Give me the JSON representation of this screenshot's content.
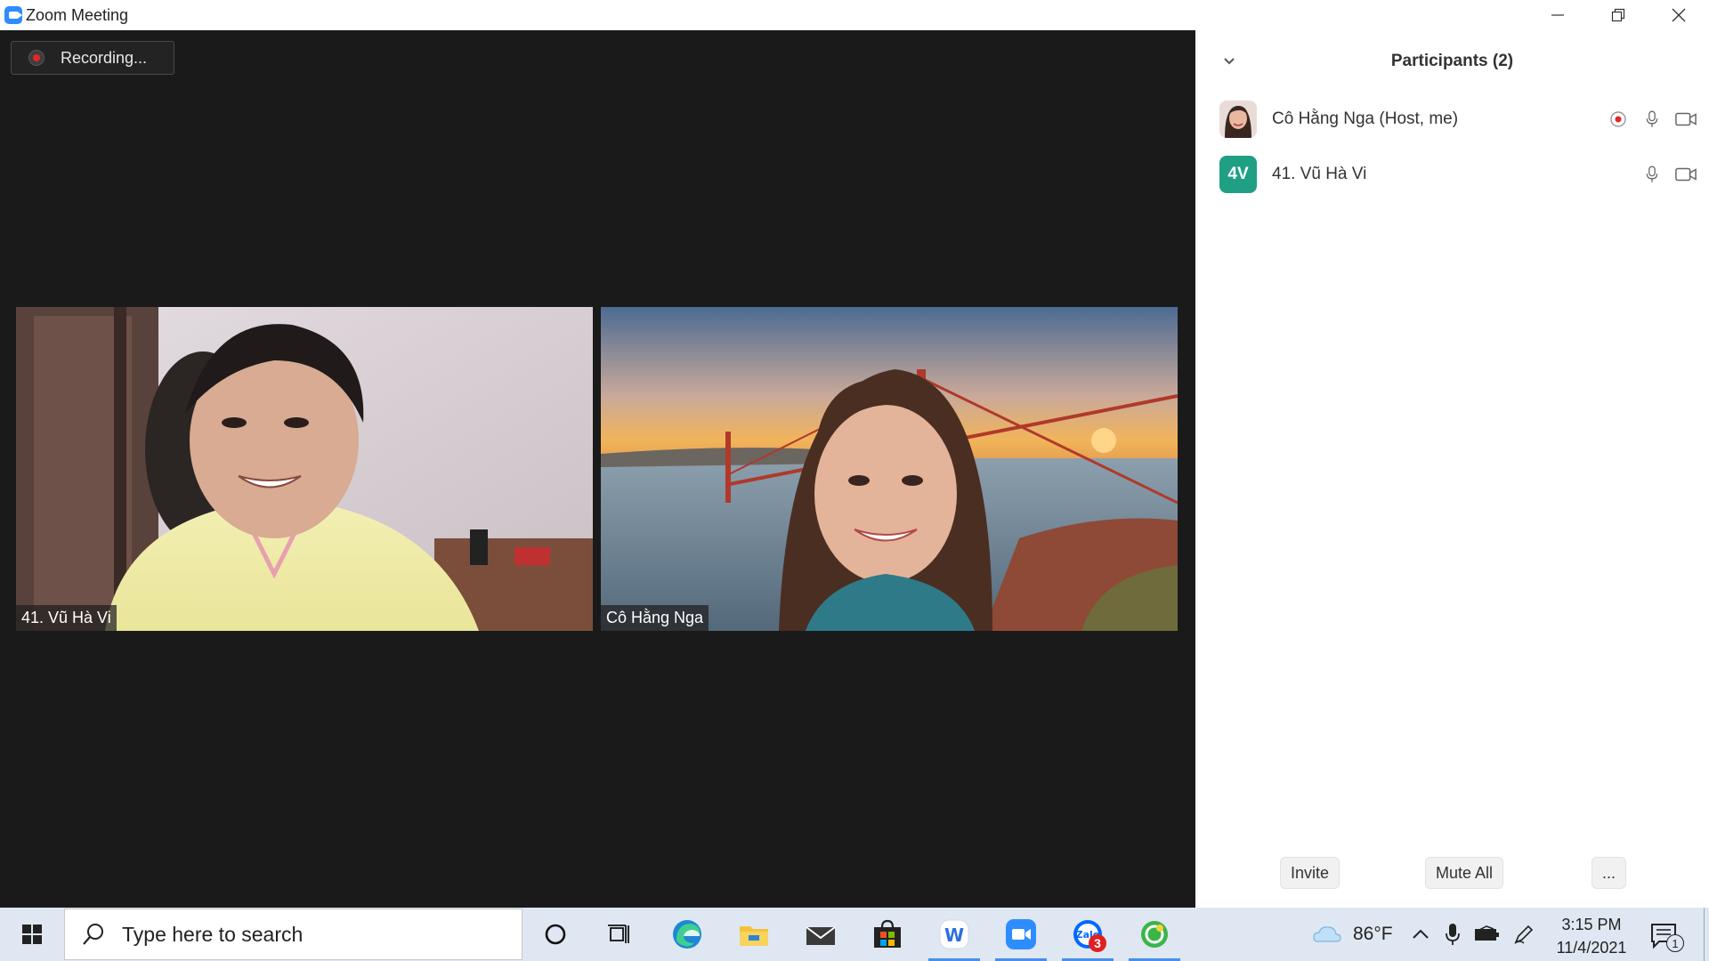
{
  "window": {
    "title": "Zoom Meeting"
  },
  "meeting": {
    "recording_label": "Recording...",
    "tiles": [
      {
        "name": "41. Vũ Hà Vi"
      },
      {
        "name": "Cô Hằng Nga"
      }
    ]
  },
  "participants_panel": {
    "title": "Participants (2)",
    "participants": [
      {
        "name": "Cô Hằng Nga (Host, me)",
        "avatar_type": "photo",
        "recording": true,
        "mic": "unmuted",
        "video": "on"
      },
      {
        "name": "41. Vũ Hà Vi",
        "avatar_initials": "4V",
        "avatar_color": "#1f9f84",
        "mic": "unmuted",
        "video": "on"
      }
    ],
    "footer": {
      "invite_label": "Invite",
      "mute_all_label": "Mute All",
      "more_label": "..."
    }
  },
  "taskbar": {
    "search_placeholder": "Type here to search",
    "apps": [
      {
        "name": "cortana-icon"
      },
      {
        "name": "task-view-icon"
      },
      {
        "name": "edge-icon"
      },
      {
        "name": "file-explorer-icon"
      },
      {
        "name": "mail-icon"
      },
      {
        "name": "store-icon"
      },
      {
        "name": "wps-writer-icon",
        "running": true
      },
      {
        "name": "zoom-icon",
        "active": true
      },
      {
        "name": "zalo-icon",
        "badge": "3",
        "running": true
      },
      {
        "name": "green-app-icon",
        "running": true
      }
    ],
    "weather_temp": "86°F",
    "time": "3:15 PM",
    "date": "11/4/2021",
    "notification_count": "1"
  },
  "colors": {
    "accent": "#2d8cff",
    "meeting_bg": "#1a1a1a",
    "record_red": "#e02828"
  }
}
